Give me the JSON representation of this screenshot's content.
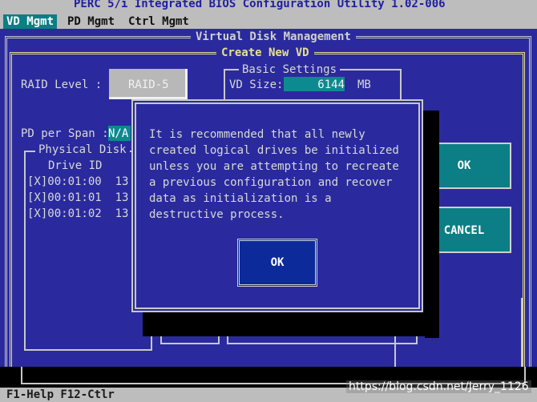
{
  "app": {
    "title": "PERC 5/i Integrated BIOS Configuration Utility 1.02-006"
  },
  "tabs": [
    {
      "label": "VD Mgmt"
    },
    {
      "label": "PD Mgmt"
    },
    {
      "label": "Ctrl Mgmt"
    }
  ],
  "frames": {
    "virtual_disk_management": "Virtual Disk Management",
    "create_new_vd": "Create New VD",
    "basic_settings": "Basic Settings",
    "physical_disks": "Physical Disk"
  },
  "form": {
    "raid_level_label": "RAID Level :",
    "raid_level_value": "RAID-5",
    "vd_size_label": "VD Size:",
    "vd_size_value": "6144",
    "vd_size_unit": "MB",
    "pd_per_span_label": "PD per Span :",
    "pd_per_span_value": "N/A"
  },
  "drives": {
    "header": "Drive ID",
    "rows": [
      {
        "text": "[X]00:01:00  13"
      },
      {
        "text": "[X]00:01:01  13"
      },
      {
        "text": "[X]00:01:02  13"
      }
    ]
  },
  "right_buttons": {
    "ok": "OK",
    "cancel": "CANCEL"
  },
  "dialog": {
    "lines": [
      "It is recommended that all newly",
      "created logical drives be initialized",
      "unless you are attempting to recreate",
      "a previous configuration and recover",
      "data as initialization is a",
      "destructive process."
    ],
    "ok": "OK"
  },
  "help": {
    "text": "F1-Help F12-Ctlr"
  },
  "watermark": "https://blog.csdn.net/Jerry_1126",
  "colors": {
    "background": "#2a2a9e",
    "highlight": "#0c7e85",
    "frame_yellow": "#e8e08c"
  }
}
